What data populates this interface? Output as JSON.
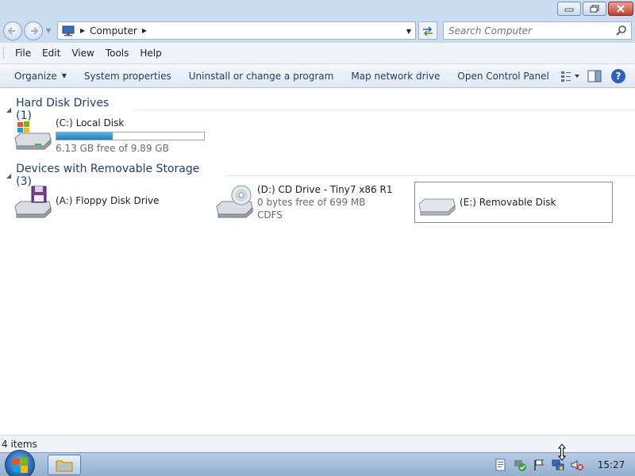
{
  "address": {
    "breadcrumb": "Computer",
    "search_placeholder": "Search Computer"
  },
  "menu": {
    "items": [
      "File",
      "Edit",
      "View",
      "Tools",
      "Help"
    ]
  },
  "toolbar": {
    "organize": "Organize",
    "system_properties": "System properties",
    "uninstall": "Uninstall or change a program",
    "map_network": "Map network drive",
    "open_control_panel": "Open Control Panel",
    "help_label": "?"
  },
  "groups": {
    "hard_disks": {
      "title": "Hard Disk Drives (1)",
      "items": [
        {
          "name": "(C:) Local Disk",
          "free": "6.13 GB free of 9.89 GB",
          "used_fraction": 0.38
        }
      ]
    },
    "removable": {
      "title": "Devices with Removable Storage (3)",
      "items": [
        {
          "name": "(A:) Floppy Disk Drive"
        },
        {
          "name": "(D:) CD Drive - Tiny7 x86 R1",
          "free": "0 bytes free of 699 MB",
          "fs": "CDFS"
        },
        {
          "name": "(E:) Removable Disk"
        }
      ]
    }
  },
  "status": {
    "items_count": "4 items"
  },
  "taskbar": {
    "clock": "15:27"
  },
  "colors": {
    "group_title": "#1e3c72",
    "progress_fill": "#1d7fbd",
    "chrome": "#c9dcf0"
  }
}
